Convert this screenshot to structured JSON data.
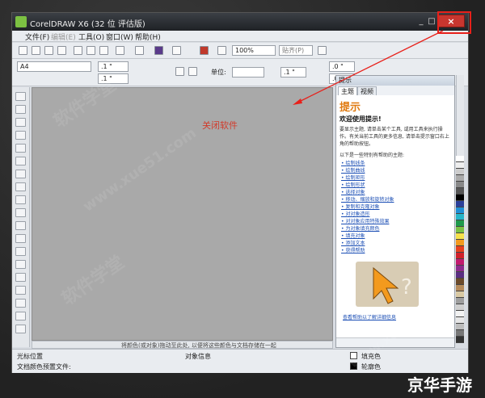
{
  "window": {
    "title": "CorelDRAW X6 (32 位 评估版)",
    "minimize": "_",
    "maximize": "□",
    "close": "×"
  },
  "menu": [
    "文件(F)",
    "编辑(E)",
    "工具(O)",
    "窗口(W)",
    "帮助(H)"
  ],
  "toolbar": {
    "zoom_value": "100%",
    "snap_label": "贴齐(P)"
  },
  "propbar": {
    "page_size": "A4",
    "width_value": ".1 \"",
    "height_value": ".1 \"",
    "unit_label": "单位:",
    "nudge_value": ".1 \"",
    "angle_value": ".0 °",
    "dup_x": ".0 \"",
    "dup_y": ".0 \""
  },
  "canvas": {
    "annotation": "关闭软件",
    "palette_hint": "将颜色(或对象)拖动至此处, 以便将这些颜色与文档存储在一起"
  },
  "docker": {
    "header": "提示",
    "tabs": [
      "主题",
      "视频"
    ],
    "tips_title": "提示",
    "welcome": "欢迎使用提示!",
    "intro": "要显示主题, 请单击某个工具, 或用工具来执行操作。有关当前工具的更多信息, 请单击提示窗口右上角的帮助按钮。",
    "sub_intro": "以下是一些特别有帮助的主题:",
    "links": [
      "绘制线条",
      "绘制曲线",
      "绘制矩形",
      "绘制形状",
      "选择对象",
      "移动、缩放和旋转对象",
      "复制和克隆对象",
      "对对象造形",
      "对对象应用特殊效果",
      "为对象填充颜色",
      "填充对象",
      "添加文本",
      "获得帮助"
    ],
    "help_link": "查看帮助以了解详细信息"
  },
  "status": {
    "cursor_pos": "光标位置",
    "object_info": "对象信息",
    "doc_color": "文档颜色预置文件:",
    "fill_color": "填充色",
    "outline_color": "轮廓色"
  },
  "palette_colors": [
    "#ffffff",
    "#eeeeee",
    "#cccccc",
    "#aaaaaa",
    "#888888",
    "#555555",
    "#000000",
    "#2a3f9a",
    "#1f8fd6",
    "#25b5c9",
    "#1e9a4c",
    "#7ac143",
    "#f5e14a",
    "#f39a1e",
    "#e8401e",
    "#d0202a",
    "#c21a6e",
    "#8e2a8c",
    "#5a2d82",
    "#6b4a2a",
    "#b58a5a",
    "#d9c9a3",
    "#9e9e9e",
    "#cfcfcf",
    "#f2f2f2",
    "#e6e6e6",
    "#bdbdbd",
    "#777777",
    "#333333"
  ],
  "watermarks": [
    "软件学堂",
    "www.xue51.com",
    "软件学堂",
    "www.xue51.com",
    "软件学堂"
  ],
  "brand": "京华手游",
  "colors": {
    "annotation_red": "#e8201a",
    "tips_orange": "#e07a10"
  }
}
